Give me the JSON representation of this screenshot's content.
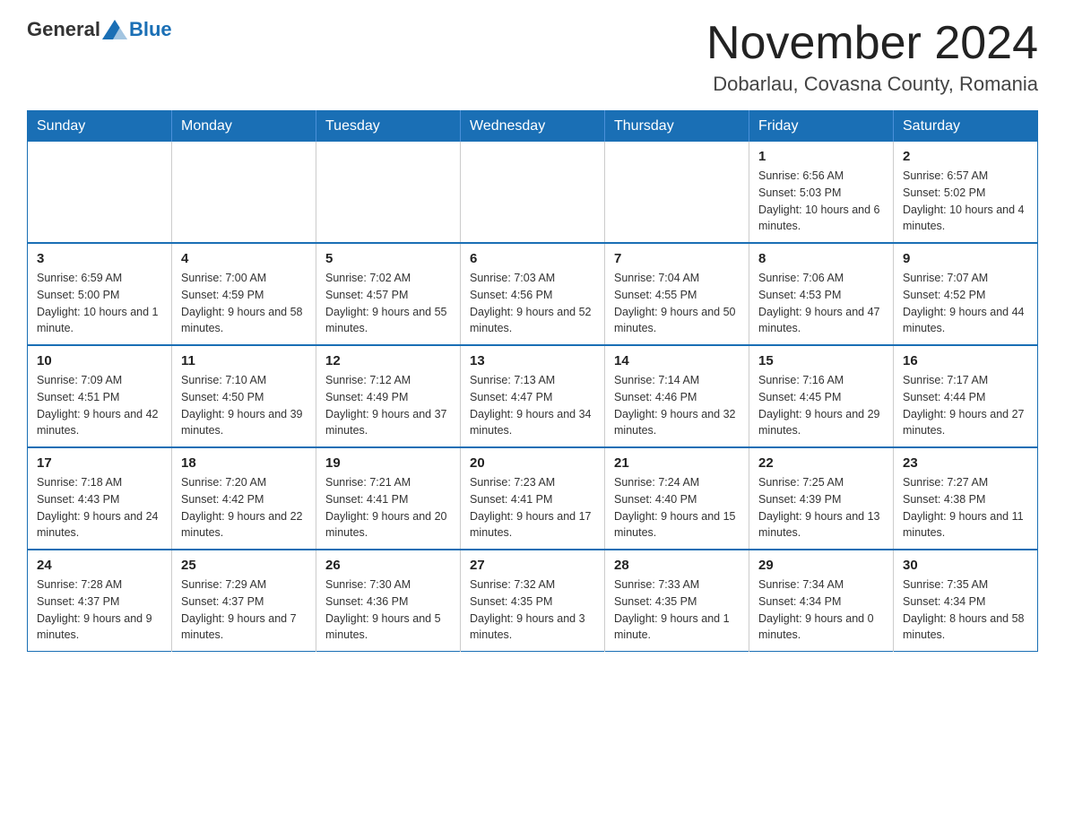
{
  "header": {
    "logo_general": "General",
    "logo_blue": "Blue",
    "title": "November 2024",
    "subtitle": "Dobarlau, Covasna County, Romania"
  },
  "weekdays": [
    "Sunday",
    "Monday",
    "Tuesday",
    "Wednesday",
    "Thursday",
    "Friday",
    "Saturday"
  ],
  "weeks": [
    [
      {
        "day": "",
        "info": ""
      },
      {
        "day": "",
        "info": ""
      },
      {
        "day": "",
        "info": ""
      },
      {
        "day": "",
        "info": ""
      },
      {
        "day": "",
        "info": ""
      },
      {
        "day": "1",
        "info": "Sunrise: 6:56 AM\nSunset: 5:03 PM\nDaylight: 10 hours and 6 minutes."
      },
      {
        "day": "2",
        "info": "Sunrise: 6:57 AM\nSunset: 5:02 PM\nDaylight: 10 hours and 4 minutes."
      }
    ],
    [
      {
        "day": "3",
        "info": "Sunrise: 6:59 AM\nSunset: 5:00 PM\nDaylight: 10 hours and 1 minute."
      },
      {
        "day": "4",
        "info": "Sunrise: 7:00 AM\nSunset: 4:59 PM\nDaylight: 9 hours and 58 minutes."
      },
      {
        "day": "5",
        "info": "Sunrise: 7:02 AM\nSunset: 4:57 PM\nDaylight: 9 hours and 55 minutes."
      },
      {
        "day": "6",
        "info": "Sunrise: 7:03 AM\nSunset: 4:56 PM\nDaylight: 9 hours and 52 minutes."
      },
      {
        "day": "7",
        "info": "Sunrise: 7:04 AM\nSunset: 4:55 PM\nDaylight: 9 hours and 50 minutes."
      },
      {
        "day": "8",
        "info": "Sunrise: 7:06 AM\nSunset: 4:53 PM\nDaylight: 9 hours and 47 minutes."
      },
      {
        "day": "9",
        "info": "Sunrise: 7:07 AM\nSunset: 4:52 PM\nDaylight: 9 hours and 44 minutes."
      }
    ],
    [
      {
        "day": "10",
        "info": "Sunrise: 7:09 AM\nSunset: 4:51 PM\nDaylight: 9 hours and 42 minutes."
      },
      {
        "day": "11",
        "info": "Sunrise: 7:10 AM\nSunset: 4:50 PM\nDaylight: 9 hours and 39 minutes."
      },
      {
        "day": "12",
        "info": "Sunrise: 7:12 AM\nSunset: 4:49 PM\nDaylight: 9 hours and 37 minutes."
      },
      {
        "day": "13",
        "info": "Sunrise: 7:13 AM\nSunset: 4:47 PM\nDaylight: 9 hours and 34 minutes."
      },
      {
        "day": "14",
        "info": "Sunrise: 7:14 AM\nSunset: 4:46 PM\nDaylight: 9 hours and 32 minutes."
      },
      {
        "day": "15",
        "info": "Sunrise: 7:16 AM\nSunset: 4:45 PM\nDaylight: 9 hours and 29 minutes."
      },
      {
        "day": "16",
        "info": "Sunrise: 7:17 AM\nSunset: 4:44 PM\nDaylight: 9 hours and 27 minutes."
      }
    ],
    [
      {
        "day": "17",
        "info": "Sunrise: 7:18 AM\nSunset: 4:43 PM\nDaylight: 9 hours and 24 minutes."
      },
      {
        "day": "18",
        "info": "Sunrise: 7:20 AM\nSunset: 4:42 PM\nDaylight: 9 hours and 22 minutes."
      },
      {
        "day": "19",
        "info": "Sunrise: 7:21 AM\nSunset: 4:41 PM\nDaylight: 9 hours and 20 minutes."
      },
      {
        "day": "20",
        "info": "Sunrise: 7:23 AM\nSunset: 4:41 PM\nDaylight: 9 hours and 17 minutes."
      },
      {
        "day": "21",
        "info": "Sunrise: 7:24 AM\nSunset: 4:40 PM\nDaylight: 9 hours and 15 minutes."
      },
      {
        "day": "22",
        "info": "Sunrise: 7:25 AM\nSunset: 4:39 PM\nDaylight: 9 hours and 13 minutes."
      },
      {
        "day": "23",
        "info": "Sunrise: 7:27 AM\nSunset: 4:38 PM\nDaylight: 9 hours and 11 minutes."
      }
    ],
    [
      {
        "day": "24",
        "info": "Sunrise: 7:28 AM\nSunset: 4:37 PM\nDaylight: 9 hours and 9 minutes."
      },
      {
        "day": "25",
        "info": "Sunrise: 7:29 AM\nSunset: 4:37 PM\nDaylight: 9 hours and 7 minutes."
      },
      {
        "day": "26",
        "info": "Sunrise: 7:30 AM\nSunset: 4:36 PM\nDaylight: 9 hours and 5 minutes."
      },
      {
        "day": "27",
        "info": "Sunrise: 7:32 AM\nSunset: 4:35 PM\nDaylight: 9 hours and 3 minutes."
      },
      {
        "day": "28",
        "info": "Sunrise: 7:33 AM\nSunset: 4:35 PM\nDaylight: 9 hours and 1 minute."
      },
      {
        "day": "29",
        "info": "Sunrise: 7:34 AM\nSunset: 4:34 PM\nDaylight: 9 hours and 0 minutes."
      },
      {
        "day": "30",
        "info": "Sunrise: 7:35 AM\nSunset: 4:34 PM\nDaylight: 8 hours and 58 minutes."
      }
    ]
  ]
}
